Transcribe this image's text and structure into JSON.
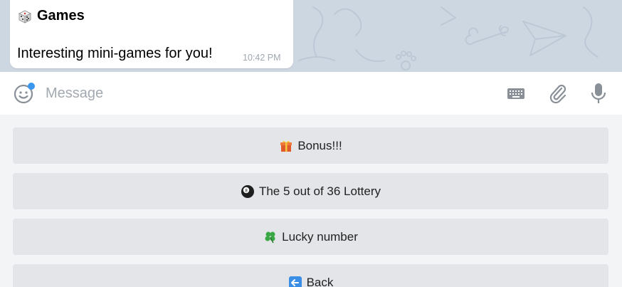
{
  "message": {
    "title": "Games",
    "title_icon": "game-die-icon",
    "text": "Interesting mini-games for you!",
    "time": "10:42 PM"
  },
  "composer": {
    "placeholder": "Message",
    "emoji_icon": "emoji-icon",
    "keyboard_icon": "keyboard-icon",
    "attach_icon": "paperclip-icon",
    "mic_icon": "microphone-icon"
  },
  "keyboard": {
    "buttons": [
      {
        "label": "Bonus!!!",
        "icon": "gift-icon"
      },
      {
        "label": "The 5 out of 36 Lottery",
        "icon": "eight-ball-icon"
      },
      {
        "label": "Lucky number",
        "icon": "four-leaf-clover-icon"
      },
      {
        "label": "Back",
        "icon": "back-arrow-icon"
      }
    ]
  },
  "colors": {
    "wallpaper": "#cdd7e2",
    "bubble": "#ffffff",
    "accent": "#3a97f0",
    "button_bg": "#e3e5e8"
  }
}
